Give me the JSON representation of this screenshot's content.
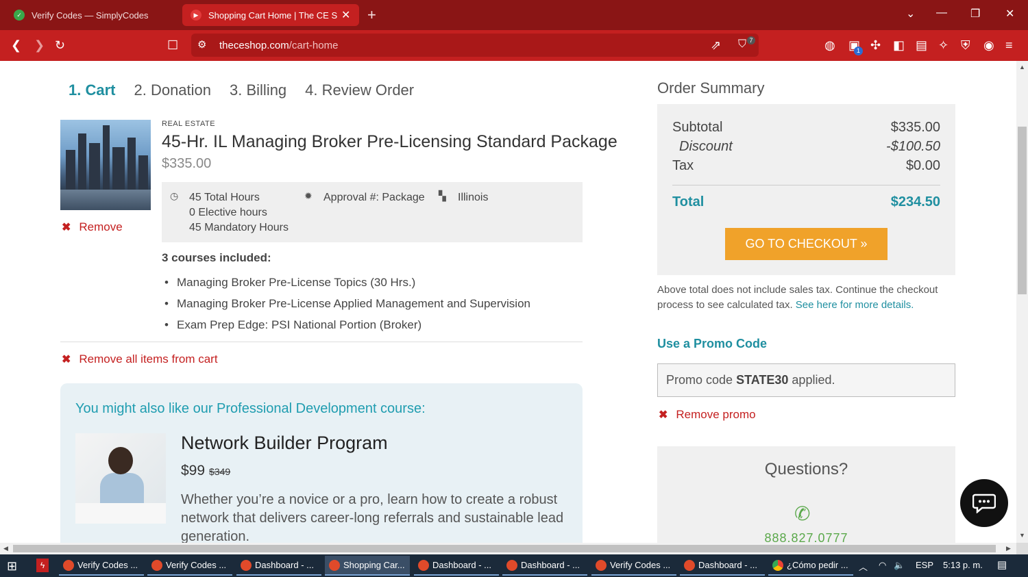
{
  "browser": {
    "tabs": [
      {
        "title": "Verify Codes — SimplyCodes",
        "active": false
      },
      {
        "title": "Shopping Cart Home | The CE Shop",
        "active": true
      }
    ],
    "new_tab": "+",
    "url_domain": "theceshop.com",
    "url_path": "/cart-home",
    "brave_badge": "7",
    "ext_badge": "1",
    "window_controls": {
      "dropdown": "⌄",
      "minimize": "—",
      "restore": "❐",
      "close": "✕"
    }
  },
  "steps": {
    "step1": "1. Cart",
    "step2": "2. Donation",
    "step3": "3. Billing",
    "step4": "4. Review Order"
  },
  "cart_item": {
    "category": "REAL ESTATE",
    "title": "45-Hr. IL Managing Broker Pre-Licensing Standard Package",
    "price": "$335.00",
    "remove_label": "Remove",
    "hours": [
      "45 Total Hours",
      "0 Elective hours",
      "45 Mandatory Hours"
    ],
    "approval": "Approval #: Package",
    "state": "Illinois",
    "courses_heading": "3 courses included:",
    "courses": [
      "Managing Broker Pre-License Topics (30 Hrs.)",
      "Managing Broker Pre-License Applied Management and Supervision",
      "Exam Prep Edge: PSI National Portion (Broker)"
    ]
  },
  "remove_all_label": "Remove all items from cart",
  "upsell": {
    "heading": "You might also like our Professional Development course:",
    "title": "Network Builder Program",
    "price": "$99",
    "old_price": "$349",
    "description": "Whether you’re a novice or a pro, learn how to create a robust network that delivers career-long referrals and sustainable lead generation."
  },
  "summary": {
    "heading": "Order Summary",
    "subtotal_label": "Subtotal",
    "subtotal": "$335.00",
    "discount_label": "Discount",
    "discount": "-$100.50",
    "tax_label": "Tax",
    "tax": "$0.00",
    "total_label": "Total",
    "total": "$234.50",
    "checkout_label": "GO TO CHECKOUT »",
    "tax_note": "Above total does not include sales tax. Continue the checkout process to see calculated tax.",
    "tax_link": "See here for more details."
  },
  "promo": {
    "heading": "Use a Promo Code",
    "applied_prefix": "Promo code ",
    "code": "STATE30",
    "applied_suffix": " applied.",
    "remove_label": "Remove promo"
  },
  "questions": {
    "heading": "Questions?",
    "phone": "888.827.0777"
  },
  "taskbar": {
    "items": [
      {
        "label": "Verify Codes ...",
        "active": false
      },
      {
        "label": "Verify Codes ...",
        "active": false
      },
      {
        "label": "Dashboard - ...",
        "active": false
      },
      {
        "label": "Shopping Car...",
        "active": true
      },
      {
        "label": "Dashboard - ...",
        "active": false
      },
      {
        "label": "Dashboard - ...",
        "active": false
      },
      {
        "label": "Verify Codes ...",
        "active": false
      },
      {
        "label": "Dashboard - ...",
        "active": false
      },
      {
        "label": "¿Cómo pedir ...",
        "active": false
      }
    ],
    "language": "ESP",
    "time": "5:13 p. m."
  },
  "colors": {
    "brand_red": "#c42020",
    "teal": "#1f8fa0",
    "orange": "#f0a22a"
  }
}
